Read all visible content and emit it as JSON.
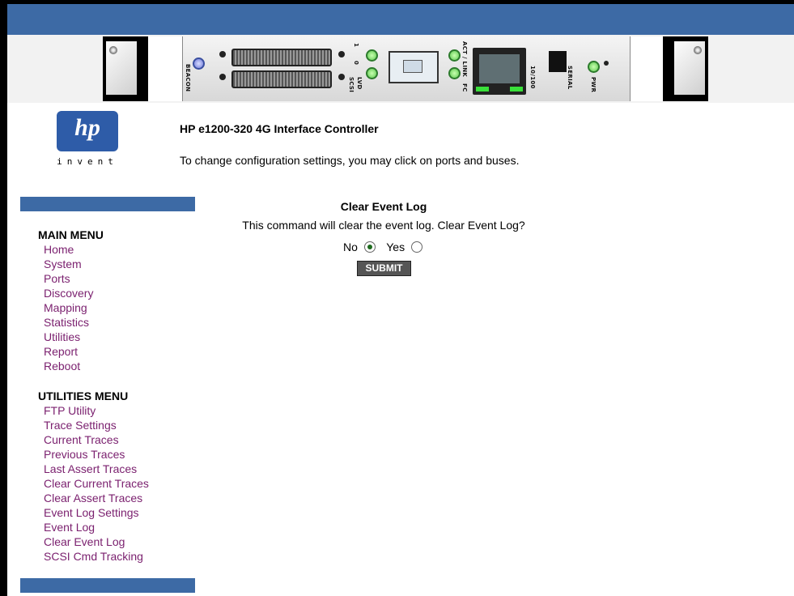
{
  "hardware_labels": {
    "beacon": "BEACON",
    "scsi": "SCSI",
    "lvd": "LVD",
    "port1": "1",
    "port0": "0",
    "act_link": "ACT / LINK",
    "fc": "FC",
    "ethernet": "10/100",
    "serial": "SERIAL",
    "pwr": "PWR"
  },
  "logo": {
    "mark": "hp",
    "tagline": "invent"
  },
  "header": {
    "title": "HP e1200-320 4G Interface Controller",
    "instruction": "To change configuration settings, you may click on ports and buses."
  },
  "main_menu": {
    "heading": "MAIN MENU",
    "items": [
      "Home",
      "System",
      "Ports",
      "Discovery",
      "Mapping",
      "Statistics",
      "Utilities",
      "Report",
      "Reboot"
    ]
  },
  "utilities_menu": {
    "heading": "UTILITIES MENU",
    "items": [
      "FTP Utility",
      "Trace Settings",
      "Current Traces",
      "Previous Traces",
      "Last Assert Traces",
      "Clear Current Traces",
      "Clear Assert Traces",
      "Event Log Settings",
      "Event Log",
      "Clear Event Log",
      "SCSI Cmd Tracking"
    ]
  },
  "dialog": {
    "title": "Clear Event Log",
    "message": "This command will clear the event log. Clear Event Log?",
    "option_no": "No",
    "option_yes": "Yes",
    "selected": "No",
    "submit_label": "SUBMIT"
  },
  "colors": {
    "accent_blue": "#3d6aa5",
    "link": "#7a1f6e",
    "led_green": "#5cc94f"
  }
}
